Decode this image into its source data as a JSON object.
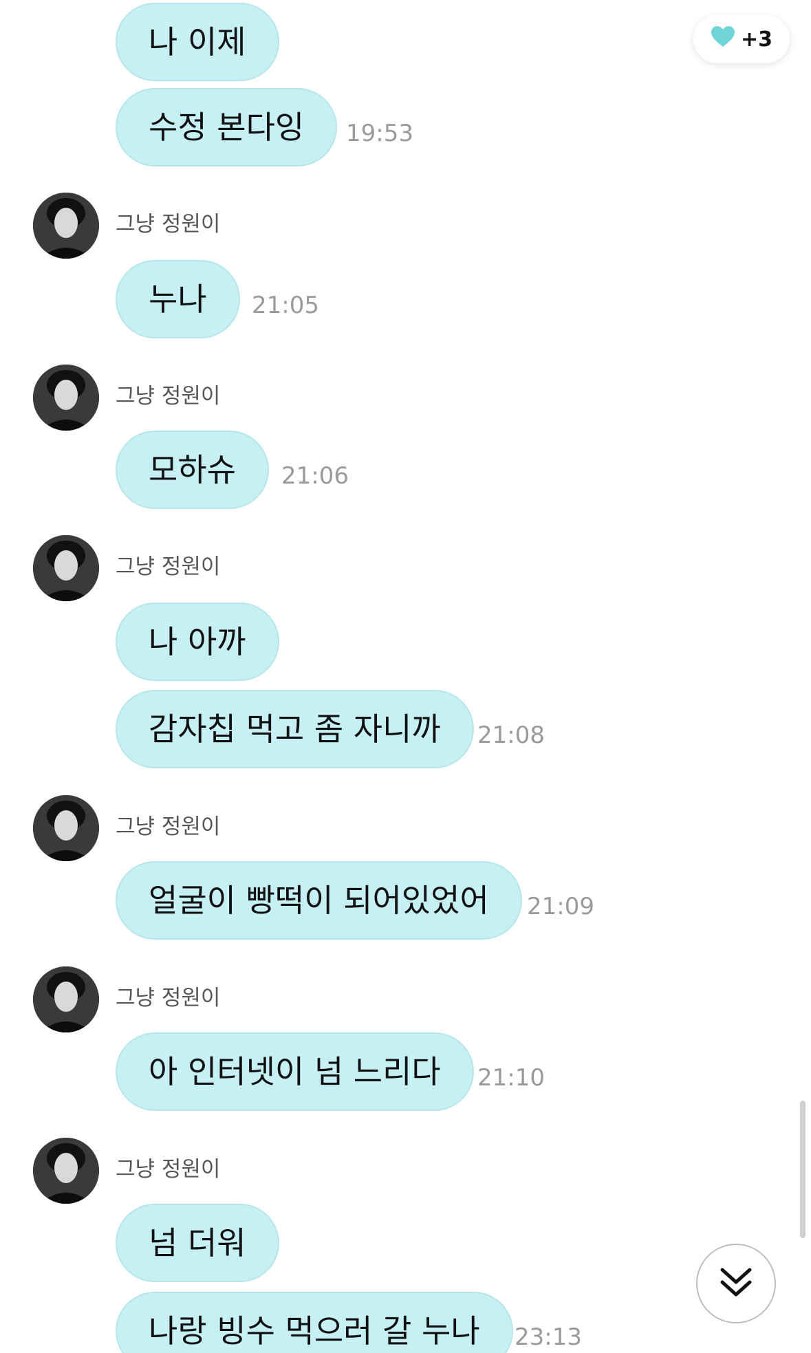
{
  "reaction": {
    "count_label": "+3",
    "icon": "heart-icon",
    "color": "#6fd3d8"
  },
  "messages": [
    {
      "text": "나 이제"
    },
    {
      "text": "수정 본다잉",
      "time": "19:53"
    },
    {
      "sender": "그냥 정원이",
      "text": "누나",
      "time": "21:05"
    },
    {
      "sender": "그냥 정원이",
      "text": "모하슈",
      "time": "21:06"
    },
    {
      "sender": "그냥 정원이",
      "text": "나 아까"
    },
    {
      "text": "감자칩 먹고 좀 자니까",
      "time": "21:08"
    },
    {
      "sender": "그냥 정원이",
      "text": "얼굴이 빵떡이 되어있었어",
      "time": "21:09"
    },
    {
      "sender": "그냥 정원이",
      "text": "아 인터넷이 넘 느리다",
      "time": "21:10"
    },
    {
      "sender": "그냥 정원이",
      "text": "넘 더워"
    },
    {
      "text": "나랑 빙수 먹으러 갈 누나",
      "time": "23:13"
    }
  ],
  "scroll_down": {
    "icon": "double-chevron-down-icon"
  }
}
